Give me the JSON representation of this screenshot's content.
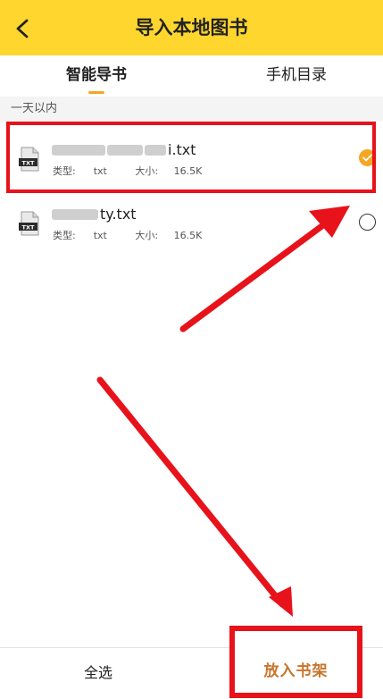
{
  "header": {
    "title": "导入本地图书",
    "back_icon": "chevron-left-icon",
    "background": "#FFD62E"
  },
  "tabs": [
    {
      "label": "智能导书",
      "active": true
    },
    {
      "label": "手机目录",
      "active": false
    }
  ],
  "section": {
    "label": "一天以内"
  },
  "files": [
    {
      "name_suffix": "i.txt",
      "type_label": "类型:",
      "type_value": "txt",
      "size_label": "大小:",
      "size_value": "16.5K",
      "selected": true,
      "icon_text": "TXT"
    },
    {
      "name_suffix": "ty.txt",
      "type_label": "类型:",
      "type_value": "txt",
      "size_label": "大小:",
      "size_value": "16.5K",
      "selected": false,
      "icon_text": "TXT"
    }
  ],
  "footer": {
    "select_all": "全选",
    "add_to_shelf": "放入书架"
  },
  "colors": {
    "accent": "#F5A623",
    "annotation_red": "#E8121B",
    "shelf_text": "#C8742B"
  }
}
